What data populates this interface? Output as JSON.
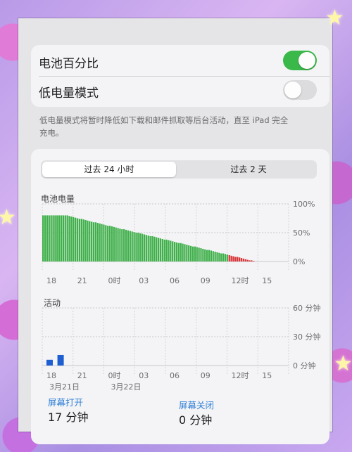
{
  "settings": {
    "battery_percentage_label": "电池百分比",
    "battery_percentage_on": true,
    "low_power_mode_label": "低电量模式",
    "low_power_mode_on": false,
    "footnote": "低电量模式将暂时降低如下载和邮件抓取等后台活动，直至 iPad 完全充电。"
  },
  "tabs": {
    "last24": "过去 24 小时",
    "last2days": "过去 2 天",
    "selected": "last24"
  },
  "colors": {
    "battery_green": "#3fb04a",
    "battery_red": "#d8363a",
    "activity_blue": "#1d5fd0",
    "toggle_on": "#3bb84a",
    "link_blue": "#2f7fd6"
  },
  "battery_chart_title": "电池电量",
  "activity_chart_title": "活动",
  "chart_data": [
    {
      "type": "bar",
      "title": "电池电量",
      "y_unit": "%",
      "ylim": [
        0,
        100
      ],
      "y_ticks": [
        "100%",
        "50%",
        "0%"
      ],
      "x_tick_labels": [
        "18",
        "21",
        "0时",
        "03",
        "06",
        "09",
        "12时",
        "15"
      ],
      "grid": true,
      "series": [
        {
          "values": [
            80,
            80,
            80,
            80,
            80,
            80,
            80,
            80,
            80,
            80,
            80,
            80,
            80,
            79,
            78,
            77,
            76,
            75,
            74,
            74,
            73,
            72,
            71,
            70,
            69,
            68,
            68,
            67,
            66,
            65,
            64,
            63,
            62,
            62,
            61,
            60,
            59,
            58,
            57,
            56,
            56,
            55,
            54,
            53,
            52,
            51,
            50,
            50,
            49,
            48,
            47,
            46,
            45,
            44,
            44,
            43,
            42,
            41,
            40,
            39,
            38,
            38,
            37,
            36,
            35,
            34,
            33,
            32,
            32,
            31,
            30,
            29,
            28,
            27,
            26,
            26,
            25,
            24,
            23,
            22,
            21,
            20,
            20,
            19,
            18,
            17,
            16,
            15,
            14,
            14,
            13,
            12,
            11,
            10,
            9,
            8,
            8,
            7,
            6,
            5,
            4,
            3,
            2,
            2,
            1
          ],
          "low_from_index": 92
        }
      ]
    },
    {
      "type": "bar",
      "title": "活动",
      "y_unit": "分钟",
      "ylim": [
        0,
        60
      ],
      "y_ticks": [
        "60 分钟",
        "30 分钟",
        "0 分钟"
      ],
      "x_tick_labels": [
        "18",
        "21",
        "0时",
        "03",
        "06",
        "09",
        "12时",
        "15"
      ],
      "date_labels": [
        "3月21日",
        "3月22日"
      ],
      "grid": true,
      "series": [
        {
          "hours": [
            0,
            1
          ],
          "values": [
            6,
            11
          ]
        }
      ]
    }
  ],
  "summary": {
    "screen_on_label": "屏幕打开",
    "screen_on_value": "17 分钟",
    "screen_off_label": "屏幕关闭",
    "screen_off_value": "0 分钟"
  }
}
